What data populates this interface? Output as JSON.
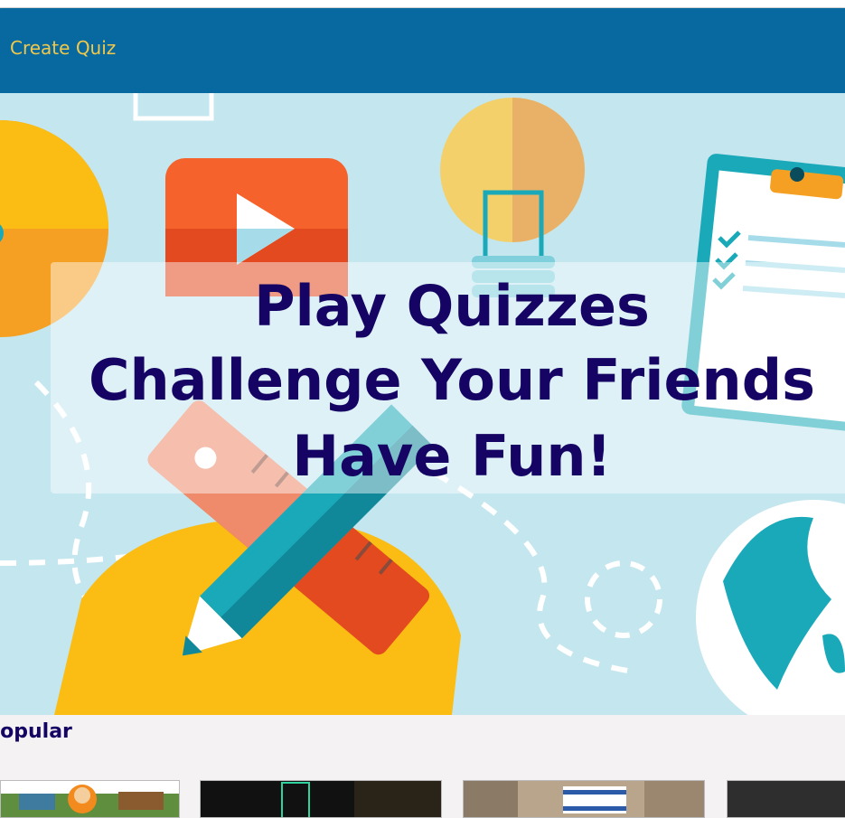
{
  "nav": {
    "create_quiz_label": "Create Quiz"
  },
  "hero": {
    "line1": "Play Quizzes",
    "line2": "Challenge Your Friends",
    "line3": "Have Fun!"
  },
  "section": {
    "title": "Popular"
  },
  "colors": {
    "navbar": "#0869a0",
    "nav_link": "#f0c84a",
    "hero_text": "#150463",
    "hero_bg": "#c4e6ee"
  }
}
